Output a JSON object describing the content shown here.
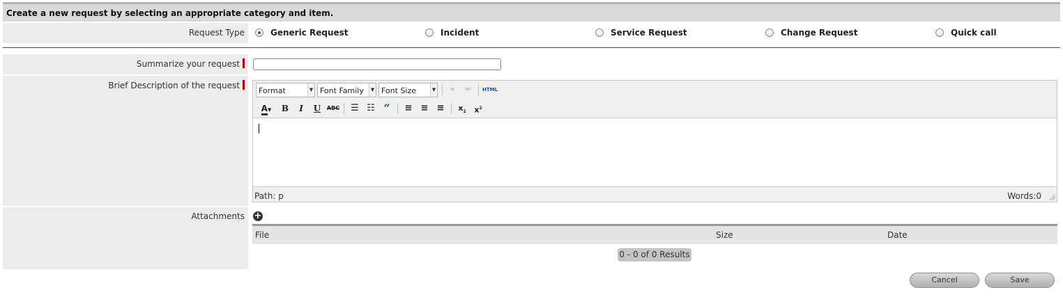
{
  "header": {
    "title": "Create a new request by selecting an appropriate category and item."
  },
  "request_type": {
    "label": "Request Type",
    "options": [
      {
        "label": "Generic Request",
        "selected": true
      },
      {
        "label": "Incident",
        "selected": false
      },
      {
        "label": "Service Request",
        "selected": false
      },
      {
        "label": "Change Request",
        "selected": false
      },
      {
        "label": "Quick call",
        "selected": false
      }
    ]
  },
  "summary": {
    "label": "Summarize your request",
    "value": "",
    "required": true
  },
  "description": {
    "label": "Brief Description of the request",
    "required": true,
    "toolbar": {
      "format": "Format",
      "font_family": "Font Family",
      "font_size": "Font Size",
      "html": "HTML",
      "icons": [
        "link-icon",
        "unlink-icon",
        "html-icon",
        "font-color-icon",
        "bold-icon",
        "italic-icon",
        "underline-icon",
        "strikethrough-icon",
        "bullet-list-icon",
        "numbered-list-icon",
        "blockquote-icon",
        "align-left-icon",
        "align-center-icon",
        "align-right-icon",
        "subscript-icon",
        "superscript-icon"
      ]
    },
    "status_path": "Path: p",
    "status_words": "Words:0"
  },
  "attachments": {
    "label": "Attachments",
    "columns": [
      "File",
      "Size",
      "Date"
    ],
    "results": "0 - 0 of 0 Results"
  },
  "actions": {
    "cancel": "Cancel",
    "save": "Save"
  },
  "colors": {
    "required_marker": "#b80000",
    "label_bg": "#ececec",
    "header_bg": "#d9d9d9"
  }
}
